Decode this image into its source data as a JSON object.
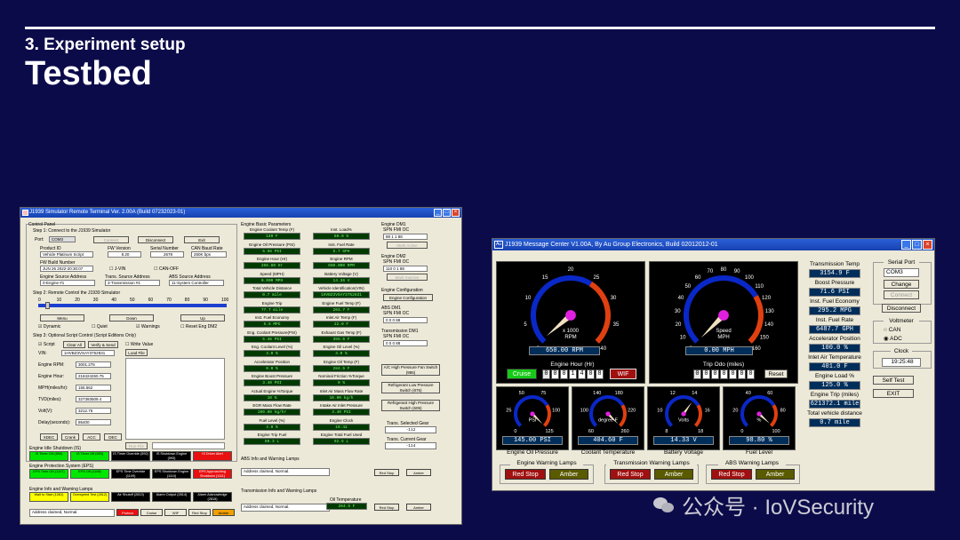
{
  "slide": {
    "section": "3. Experiment setup",
    "title": "Testbed"
  },
  "sim": {
    "title": "J1939 Simulator Remote Terminal Ver. 2.00A (Build 07232023-01)",
    "control_panel": "Control Panel",
    "step1": "Step 1: Connect to the J1939 Simulator",
    "port_label": "Port:",
    "port_value": "COM3",
    "connect": "Connect",
    "disconnect": "Disconnect",
    "exit": "Exit",
    "product_id_label": "Product ID",
    "product_id_value": "Vehicle Platinum Script",
    "fw_version_label": "FW Version",
    "fw_version_value": "8.20",
    "serial_label": "Serial Number",
    "serial_value": "2678",
    "can_baud_label": "CAN Baud Rate",
    "can_baud_value": "250K bps",
    "fw_build_label": "FW Build Number",
    "fw_build_value": "JUN 26 2022-20:30:07",
    "j_vin": "J-VIN",
    "can_off": "CAN-OFF",
    "engine_src_label": "Engine Source Address",
    "engine_src_value": "0-Engine #1",
    "trans_src_label": "Trans. Source Address",
    "trans_src_value": "3-Transmission #1",
    "abs_src_label": "ABS Source Address",
    "abs_src_value": "11-System Controller",
    "step2": "Step 2: Remote Control the J1939 Simulator",
    "scale": [
      "0",
      "10",
      "20",
      "30",
      "40",
      "50",
      "60",
      "70",
      "80",
      "90",
      "100"
    ],
    "menu": "Menu",
    "down": "Down",
    "up": "Up",
    "dynamic": "Dynamic",
    "quiet": "Quiet",
    "warnings": "Warnings",
    "reset_dm2": "Reset Eng DM2",
    "step3": "Step 3: Optional Script Control (Script Editions Only)",
    "script": "Script",
    "clear_all": "Clear All",
    "verify_send": "Verify & Send",
    "write_value": "Write Value",
    "load_file": "Load File",
    "run_file": "Run File",
    "fields": [
      {
        "label": "VIN:",
        "value": "1HVBZ3VSAY3752831"
      },
      {
        "label": "Engine RPM:",
        "value": "3001.275"
      },
      {
        "label": "Engine Hour:",
        "value": "218424260.75"
      },
      {
        "label": "MPH(miles/hr):",
        "value": "155.562"
      },
      {
        "label": "TVD(miles):",
        "value": "327393509.4"
      },
      {
        "label": "Volt(V):",
        "value": "3212.75"
      },
      {
        "label": "Delay(seconds):",
        "value": "86400"
      }
    ],
    "bottom_buttons": [
      "XDEC",
      "Crank",
      "ACC",
      "DEC"
    ],
    "idle_title": "Engine Idle Shutdown (IS)",
    "idle_lamps": [
      {
        "text": "IS Timer ON (590)",
        "color": "#00e600"
      },
      {
        "text": "IS Timer Off (590)",
        "color": "#00e600"
      },
      {
        "text": "IS Timer Override (592)",
        "color": "#000000"
      },
      {
        "text": "IS Shutdown Engine (593)",
        "color": "#000000"
      },
      {
        "text": "IS Driver Alert",
        "color": "#e81010"
      }
    ],
    "eps_title": "Engine Protection System (EPS)",
    "eps_lamps": [
      {
        "text": "EPS Time ON (1107)",
        "color": "#00e600"
      },
      {
        "text": "EPS Off (1108)",
        "color": "#00e600"
      },
      {
        "text": "EPS Time Override (1109)",
        "color": "#000000"
      },
      {
        "text": "EPS Shutdown Engine (1110)",
        "color": "#000000"
      },
      {
        "text": "EPS Approaching Shutdown (1111)",
        "color": "#e81010"
      }
    ],
    "warn_title": "Engine Info and Warning Lamps",
    "warn_lamps": [
      {
        "text": "Wait to Start (1081)",
        "color": "#ffff00"
      },
      {
        "text": "Overspeed Test (2812)",
        "color": "#ffff00"
      },
      {
        "text": "Air Shutoff (2813)",
        "color": "#000000"
      },
      {
        "text": "Alarm Output (2814)",
        "color": "#000000"
      },
      {
        "text": "Alarm Acknowledge (2815)",
        "color": "#000000"
      }
    ],
    "address_claimed": "Address claimed, Normal.",
    "status_buttons": [
      "Protect",
      "Cruise",
      "WIF",
      "Red Stop",
      "Amber"
    ],
    "basic_params_title": "Engine Basic Parameters",
    "params": [
      {
        "label": "Engine Coolant Temp (F)",
        "value": "140 F"
      },
      {
        "label": "Inst. Load%",
        "value": "60.0 %"
      },
      {
        "label": "Engine Oil Pressure (PSI)",
        "value": "6.56 PSI"
      },
      {
        "label": "Inst. Fuel Rate",
        "value": "5.7 GPH"
      },
      {
        "label": "Engine Hour (Hr)",
        "value": "266.80 Hr"
      },
      {
        "label": "Engine RPM",
        "value": "650.000 RPM"
      },
      {
        "label": "Speed (MPH)",
        "value": "0.000 MPH"
      },
      {
        "label": "Battery Voltage (V)",
        "value": "14.36 V"
      },
      {
        "label": "Total Vehicle Distance",
        "value": "0.7 mile"
      },
      {
        "label": "Vehicle Identification(VIN)",
        "value": "1HVBZ3VSAY3752831"
      },
      {
        "label": "Engine Trip",
        "value": "77.7 mile"
      },
      {
        "label": "Engine Fuel Temp (F)",
        "value": "204.7 F"
      },
      {
        "label": "Inst. Fuel Economy",
        "value": "5.6 MPG"
      },
      {
        "label": "Inlet Air Temp (F)",
        "value": "22.0 F"
      },
      {
        "label": "Eng. Coolant Pressure(PSI)",
        "value": "5.46 PSI"
      },
      {
        "label": "Exhaust Gas Temp (F)",
        "value": "355.6 F"
      },
      {
        "label": "Eng. Coolant Level (%)",
        "value": "4.0 %"
      },
      {
        "label": "Engine Oil Level (%)",
        "value": "4.0 %"
      },
      {
        "label": "Accelerator Position",
        "value": "0.0 %"
      },
      {
        "label": "Engine Oil Temp (F)",
        "value": "284.5 F"
      },
      {
        "label": "Engine Boost Pressure",
        "value": "3.40 PSI"
      },
      {
        "label": "Nominal Friction %Torque",
        "value": "0 %"
      },
      {
        "label": "Actual Engine %Torque",
        "value": "10 %"
      },
      {
        "label": "Inlet Air Mass Flow Rate",
        "value": "10.00 kg/h"
      },
      {
        "label": "EGR Mass Flow Rate",
        "value": "100.00 kg/hr"
      },
      {
        "label": "Intake Air Inlet Pressure",
        "value": "3.40 PSI"
      },
      {
        "label": "Fuel Level (%)",
        "value": "4.0 %"
      },
      {
        "label": "Engine Clock",
        "value": "19:42"
      },
      {
        "label": "Engine Trip Fuel",
        "value": "80.3 L"
      },
      {
        "label": "Engine Total Fuel Used",
        "value": "92.5 L"
      }
    ],
    "dm_title1": "Engine DM1",
    "dm_title2": "Engine DM2",
    "dm_title3": "ABS DM1",
    "dm_title4": "Transmission DM1",
    "spn_fmi": "SPN  FMI  OC",
    "engine_config": "Engine Configuration",
    "ac_button": "A/C High Pressure Fan Switch (985)",
    "refrig_low": "Refrigerant Low Pressure Switch (875)",
    "refrig_high": "Refrigerant High Pressure Switch (605)",
    "trans_selected": "Trans. Selected Gear",
    "trans_selected_val": "-112",
    "trans_current": "Trans. Current Gear",
    "trans_current_val": "-114",
    "abs_title": "ABS Info and Warning Lamps",
    "abs_status": "Address claimed, Normal.",
    "trans_title": "Transmission Info and Warning Lamps",
    "trans_status": "Address claimed, Normal.",
    "oil_temp_label": "Oil Temperature",
    "oil_temp_value": "264.5 F",
    "red_stop": "Red Stop",
    "amber": "Amber"
  },
  "mc": {
    "title": "J1939 Message Center V1.00A, By Au Group Electronics, Build 02012012-01",
    "app_icon": "Au",
    "rpm_gauge": {
      "ticks": [
        "0",
        "5",
        "10",
        "15",
        "20",
        "25",
        "30",
        "35",
        "40"
      ],
      "unit": "x 1000\nRPM",
      "unit1": "x 1000",
      "unit2": "RPM",
      "value": "650.00 RPM",
      "level": 0.016
    },
    "speed_gauge": {
      "ticks": [
        "0",
        "10",
        "20",
        "30",
        "40",
        "50",
        "60",
        "70",
        "80",
        "90",
        "100",
        "110",
        "120",
        "130",
        "140",
        "150",
        "160"
      ],
      "unit1": "Speed",
      "unit2": "MPH",
      "value": "0.00 MPH",
      "level": 0.0
    },
    "cruise": "Cruise",
    "wif": "WIF",
    "reset": "Reset",
    "engine_hour_label": "Engine Hour (Hr)",
    "engine_hour_digits": [
      "0",
      "0",
      "0",
      "1",
      "4",
      "0",
      "8"
    ],
    "trip_label": "Trip Odo (miles)",
    "trip_digits": [
      "0",
      "0",
      "0",
      "0",
      "0",
      "0",
      "0"
    ],
    "small_gauges": [
      {
        "label": "Engine Oil Pressure",
        "unit": "PSI",
        "ticks": [
          "0",
          "25",
          "50",
          "75",
          "100",
          "125"
        ],
        "value": "145.00 PSI",
        "level": 1.0
      },
      {
        "label": "Coolant Temperature",
        "unit": "degree F",
        "ticks": [
          "60",
          "100",
          "140",
          "180",
          "220",
          "260"
        ],
        "value": "404.60 F",
        "level": 1.0
      },
      {
        "label": "Battery Voltage",
        "unit": "Volts",
        "ticks": [
          "8",
          "10",
          "12",
          "14",
          "16",
          "18"
        ],
        "value": "14.33 V",
        "level": 0.63
      },
      {
        "label": "Fuel Level",
        "unit": "%",
        "ticks": [
          "0",
          "20",
          "40",
          "60",
          "80",
          "100"
        ],
        "value": "98.80 %",
        "level": 0.99
      }
    ],
    "readouts": [
      {
        "label": "Transmission Temp",
        "value": "3154.9 F"
      },
      {
        "label": "Boost Pressure",
        "value": "71.6 PSI"
      },
      {
        "label": "Inst. Fuel Economy",
        "value": "295.2 MPG"
      },
      {
        "label": "Inst. Fuel Rate",
        "value": "6487.7 GPH"
      },
      {
        "label": "Accelerator Position",
        "value": "100.0 %"
      },
      {
        "label": "Inlet Air Temperature",
        "value": "401.0 F"
      },
      {
        "label": "Engine Load %",
        "value": "125.0 %"
      },
      {
        "label": "Engine Trip (miles)",
        "value": "621372.1 mile"
      },
      {
        "label": "Total vehicle distance",
        "value": "0.7 mile"
      }
    ],
    "serial_port_label": "Serial Port",
    "serial_port_value": "COM3",
    "change": "Change",
    "connect": "Connect",
    "disconnect": "Disconnect",
    "voltmeter": "Voltmeter",
    "can": "CAN",
    "adc": "ADC",
    "clock_label": "Clock",
    "clock_value": "19:25:48",
    "self_test": "Self Test",
    "exit": "EXIT",
    "engine_warning_title": "Engine Warning Lamps",
    "trans_warning_title": "Transmission Warning Lamps",
    "abs_warning_title": "ABS Warning Lamps",
    "red_stop": "Red Stop",
    "amber": "Amber",
    "colors": {
      "red_stop": "#a01010",
      "amber": "#5a5a00",
      "dial_blue": "#0a28c8",
      "dial_red": "#e04010",
      "needle": "#f0e0c0",
      "hub": "#e020e0"
    }
  },
  "watermark": "公众号 · IoVSecurity"
}
